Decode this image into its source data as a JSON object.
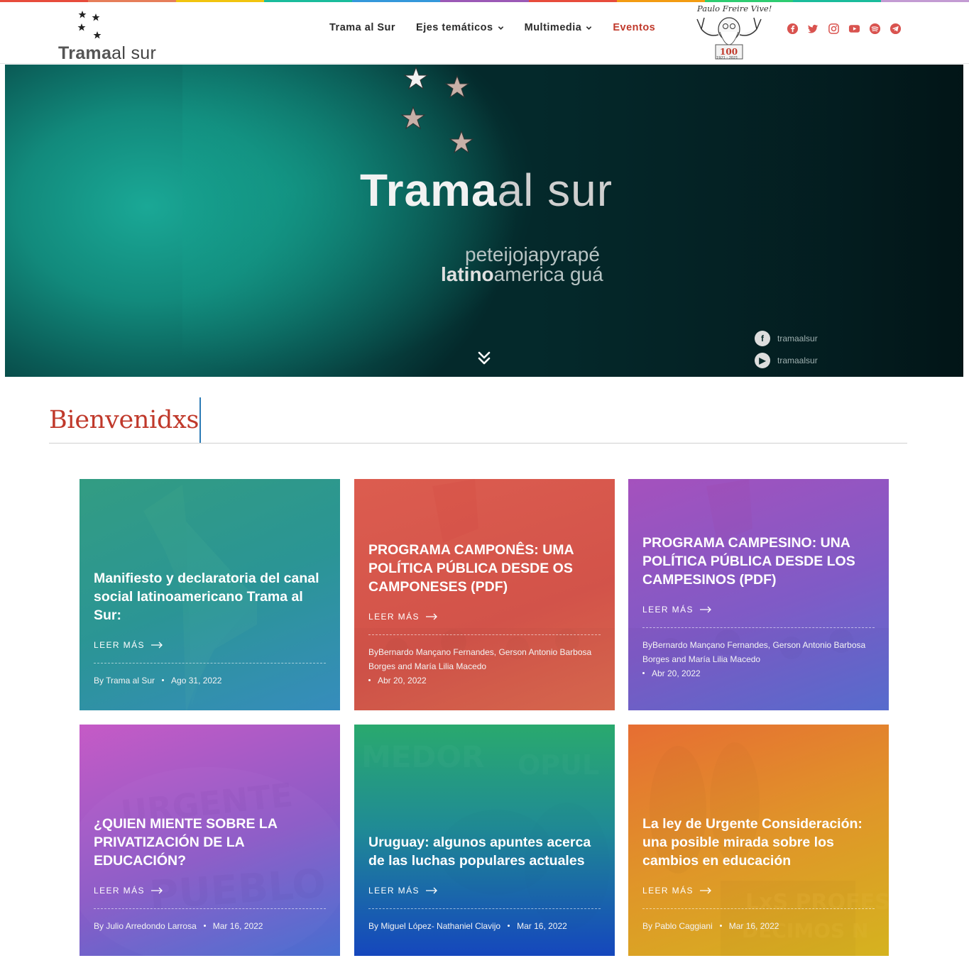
{
  "palette": {
    "rainbow": [
      "#e74c3c",
      "#e67e5a",
      "#f1c40f",
      "#1abc9c",
      "#3498db",
      "#9b59b6",
      "#e74c3c",
      "#f39c12",
      "#2ecc71",
      "#1abc9c",
      "#c39bd3"
    ],
    "accent": "#c0392b",
    "nav_text": "#2b2b2b",
    "social": "#d9534f"
  },
  "header": {
    "logo": {
      "bold": "Trama",
      "light": "al sur"
    },
    "nav": [
      {
        "label": "Trama al Sur",
        "has_dropdown": false,
        "active": false
      },
      {
        "label": "Ejes temáticos",
        "has_dropdown": true,
        "active": false
      },
      {
        "label": "Multimedia",
        "has_dropdown": true,
        "active": false
      },
      {
        "label": "Eventos",
        "has_dropdown": false,
        "active": true
      }
    ],
    "freire": {
      "caption": "Paulo Freire Vive!",
      "number": "100",
      "years": "1921 - 2021"
    },
    "social_icons": [
      "facebook-icon",
      "twitter-icon",
      "instagram-icon",
      "youtube-icon",
      "spotify-icon",
      "telegram-icon"
    ]
  },
  "hero": {
    "title_bold": "Trama",
    "title_light": "al sur",
    "subtitle_line1": "peteijojapyrapé",
    "subtitle_line2_bold": "latino",
    "subtitle_line2_light": "america guá",
    "social_facebook": "tramaalsur",
    "social_youtube": "tramaalsur",
    "scroll_icon": "double-chevron-down-icon"
  },
  "welcome": {
    "title": "Bienvenidxs"
  },
  "posts": [
    {
      "title": "Manifiesto y declaratoria del canal social latinoamericano Trama al Sur:",
      "more": "LEER MÁS",
      "author": "By Trama al Sur",
      "date": "Ago 31, 2022",
      "tint": "linear-gradient(160deg, rgba(46,156,130,0.9) 0%, rgba(40,150,150,0.88) 50%, rgba(52,140,190,0.9) 100%)"
    },
    {
      "title": "PROGRAMA CAMPONÊS: UMA POLÍTICA PÚBLICA DESDE OS CAMPONESES (PDF)",
      "more": "LEER MÁS",
      "author": "ByBernardo Mançano Fernandes, Gerson Antonio Barbosa Borges and María Lilia Macedo",
      "date": "Abr 20, 2022",
      "tint": "linear-gradient(160deg, rgba(222,92,78,0.9) 0%, rgba(214,84,74,0.88) 60%, rgba(222,108,80,0.9) 100%)"
    },
    {
      "title": "PROGRAMA CAMPESINO: UNA POLÍTICA PÚBLICA DESDE LOS CAMPESINOS (PDF)",
      "more": "LEER MÁS",
      "author": "ByBernardo Mançano Fernandes, Gerson Antonio Barbosa Borges and María Lilia Macedo",
      "date": "Abr 20, 2022",
      "tint": "linear-gradient(160deg, rgba(166,80,190,0.9) 0%, rgba(128,90,200,0.88) 55%, rgba(88,110,210,0.9) 100%)"
    },
    {
      "title": "¿QUIEN MIENTE SOBRE LA PRIVATIZACIÓN DE LA EDUCACIÓN?",
      "more": "LEER MÁS",
      "author": "By Julio Arredondo Larrosa",
      "date": "Mar 16, 2022",
      "tint": "linear-gradient(160deg, rgba(200,90,200,0.9) 0%, rgba(140,90,200,0.88) 55%, rgba(70,110,210,0.9) 100%)"
    },
    {
      "title": "Uruguay: algunos apuntes acerca de las luchas populares actuales",
      "more": "LEER MÁS",
      "author": "By Miguel López- Nathaniel Clavijo",
      "date": "Mar 16, 2022",
      "tint": "linear-gradient(180deg, rgba(40,170,110,0.92) 0%, rgba(30,140,150,0.88) 45%, rgba(20,70,190,0.92) 100%)"
    },
    {
      "title": "La ley de Urgente Consideración: una posible mirada sobre los cambios en educación",
      "more": "LEER MÁS",
      "author": "By Pablo Caggiani",
      "date": "Mar 16, 2022",
      "tint": "linear-gradient(160deg, rgba(232,110,50,0.9) 0%, rgba(226,150,40,0.88) 50%, rgba(214,180,30,0.9) 100%)"
    }
  ]
}
